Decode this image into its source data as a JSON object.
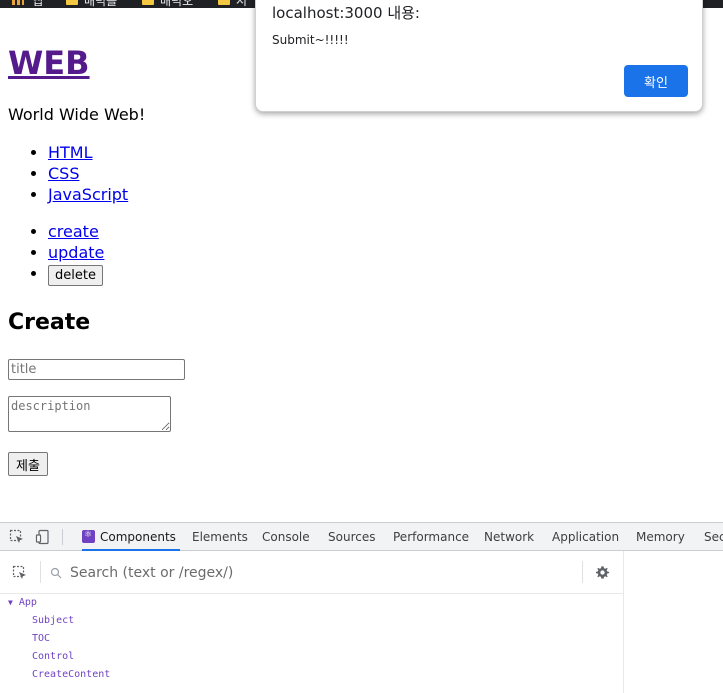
{
  "bookmarks": {
    "apps_label": "앱",
    "items": [
      "배덕볼",
      "배덕오",
      "시"
    ]
  },
  "page": {
    "site_title": "WEB",
    "intro": "World Wide Web!",
    "toc": [
      "HTML",
      "CSS",
      "JavaScript"
    ],
    "controls": {
      "create": "create",
      "update": "update",
      "delete": "delete"
    },
    "form": {
      "heading": "Create",
      "title_placeholder": "title",
      "description_placeholder": "description",
      "submit_label": "제출"
    }
  },
  "alert": {
    "title": "localhost:3000 내용:",
    "message": "Submit~!!!!!",
    "ok_label": "확인",
    "ok_color": "#1a73e8"
  },
  "devtools": {
    "tabs": [
      "Components",
      "Elements",
      "Console",
      "Sources",
      "Performance",
      "Network",
      "Application",
      "Memory",
      "Sec"
    ],
    "active_tab": "Components",
    "search_placeholder": "Search (text or /regex/)",
    "tree": {
      "root": "App",
      "children": [
        "Subject",
        "TOC",
        "Control",
        "CreateContent"
      ]
    },
    "accent_color": "#1a73e8",
    "component_color": "#6f42c1"
  }
}
